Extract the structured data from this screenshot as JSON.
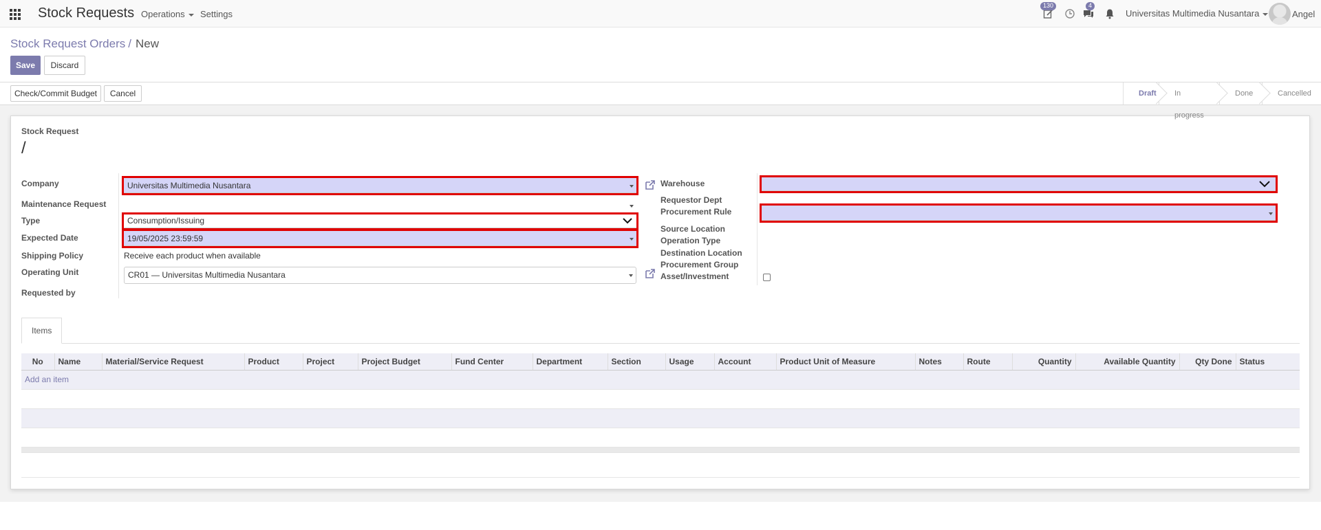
{
  "navbar": {
    "app_title": "Stock Requests",
    "menu_operations": "Operations",
    "menu_settings": "Settings",
    "activity_badge": "130",
    "messages_badge": "4",
    "company": "Universitas Multimedia Nusantara",
    "user": "Angel"
  },
  "breadcrumb": {
    "parent": "Stock Request Orders",
    "separator": "/",
    "current": "New"
  },
  "buttons": {
    "save": "Save",
    "discard": "Discard",
    "check_commit": "Check/Commit Budget",
    "cancel": "Cancel"
  },
  "stages": [
    "Draft",
    "In progress",
    "Done",
    "Cancelled"
  ],
  "active_stage": "Draft",
  "form": {
    "title_label": "Stock Request",
    "name": "/",
    "left": {
      "company_label": "Company",
      "company_value": "Universitas Multimedia Nusantara",
      "maintenance_label": "Maintenance Request",
      "maintenance_value": "",
      "type_label": "Type",
      "type_value": "Consumption/Issuing",
      "expected_date_label": "Expected Date",
      "expected_date_value": "19/05/2025 23:59:59",
      "shipping_policy_label": "Shipping Policy",
      "shipping_policy_value": "Receive each product when available",
      "operating_unit_label": "Operating Unit",
      "operating_unit_value": "CR01 — Universitas Multimedia Nusantara",
      "requested_by_label": "Requested by"
    },
    "right": {
      "warehouse_label": "Warehouse",
      "requestor_dept_label": "Requestor Dept",
      "procurement_rule_label": "Procurement Rule",
      "source_location_label": "Source Location",
      "operation_type_label": "Operation Type",
      "destination_location_label": "Destination Location",
      "procurement_group_label": "Procurement Group",
      "asset_investment_label": "Asset/Investment"
    }
  },
  "tabs": {
    "items": "Items"
  },
  "table": {
    "columns": [
      "No",
      "Name",
      "Material/Service Request",
      "Product",
      "Project",
      "Project Budget",
      "Fund Center",
      "Department",
      "Section",
      "Usage",
      "Account",
      "Product Unit of Measure",
      "Notes",
      "Route",
      "Quantity",
      "Available Quantity",
      "Qty Done",
      "Status"
    ],
    "add_item": "Add an item"
  },
  "colors": {
    "accent": "#7c7bad",
    "highlight": "#d5d5f8",
    "annotation_red": "#e00000"
  }
}
